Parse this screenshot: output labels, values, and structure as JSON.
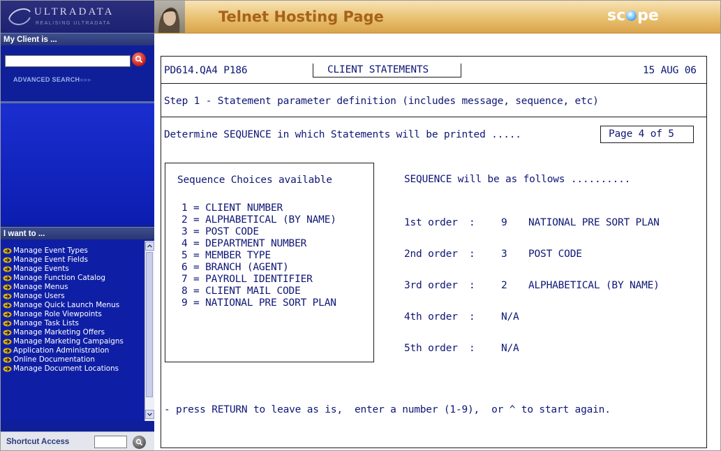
{
  "sidebar": {
    "logo_text": "ULTRADATA",
    "logo_tagline": "REALISING ULTRADATA",
    "client_heading": "My Client is ...",
    "client_input_value": "",
    "advanced_search": "ADVANCED SEARCH",
    "advanced_search_arrows": "»»»",
    "want_heading": "I want to ...",
    "menu_items": [
      "Manage Event Types",
      "Manage Event Fields",
      "Manage Events",
      "Manage Function Catalog",
      "Manage Menus",
      "Manage Users",
      "Manage Quick Launch Menus",
      "Manage Role Viewpoints",
      "Manage Task Lists",
      "Manage Marketing Offers",
      "Manage Marketing Campaigns",
      "Application Administration",
      "Online Documentation",
      "Manage Document Locations"
    ],
    "shortcut_label": "Shortcut Access",
    "shortcut_value": ""
  },
  "header": {
    "title": "Telnet Hosting Page",
    "brand_left": "sc",
    "brand_right": "pe"
  },
  "terminal": {
    "program_id": "PD614.QA4 P186",
    "screen_title": "CLIENT STATEMENTS",
    "date": "15 AUG 06",
    "step": "Step 1 - Statement parameter definition (includes message, sequence, etc)",
    "instruction": "Determine SEQUENCE in which Statements will be printed .....",
    "page": "Page 4 of 5",
    "choices_heading": "Sequence Choices available",
    "choices": [
      "1 = CLIENT NUMBER",
      "2 = ALPHABETICAL (BY NAME)",
      "3 = POST CODE",
      "4 = DEPARTMENT NUMBER",
      "5 = MEMBER TYPE",
      "6 = BRANCH (AGENT)",
      "7 = PAYROLL IDENTIFIER",
      "8 = CLIENT MAIL CODE",
      "9 = NATIONAL PRE SORT PLAN"
    ],
    "order_heading": "SEQUENCE will be as follows ..........",
    "orders": [
      {
        "label": "1st order",
        "sep": ":",
        "code": "9",
        "desc": "NATIONAL PRE SORT PLAN"
      },
      {
        "label": "2nd order",
        "sep": ":",
        "code": "3",
        "desc": "POST CODE"
      },
      {
        "label": "3rd order",
        "sep": ":",
        "code": "2",
        "desc": "ALPHABETICAL (BY NAME)"
      },
      {
        "label": "4th order",
        "sep": ":",
        "code": "N/A",
        "desc": ""
      },
      {
        "label": "5th order",
        "sep": ":",
        "code": "N/A",
        "desc": ""
      }
    ],
    "prompt": "- press RETURN to leave as is,  enter a number (1-9),  or ^ to start again."
  },
  "colors": {
    "sidebar_blue": "#0f1f9a",
    "terminal_text": "#0e1675",
    "header_title": "#a6621a",
    "header_gold": "#e9c070"
  }
}
